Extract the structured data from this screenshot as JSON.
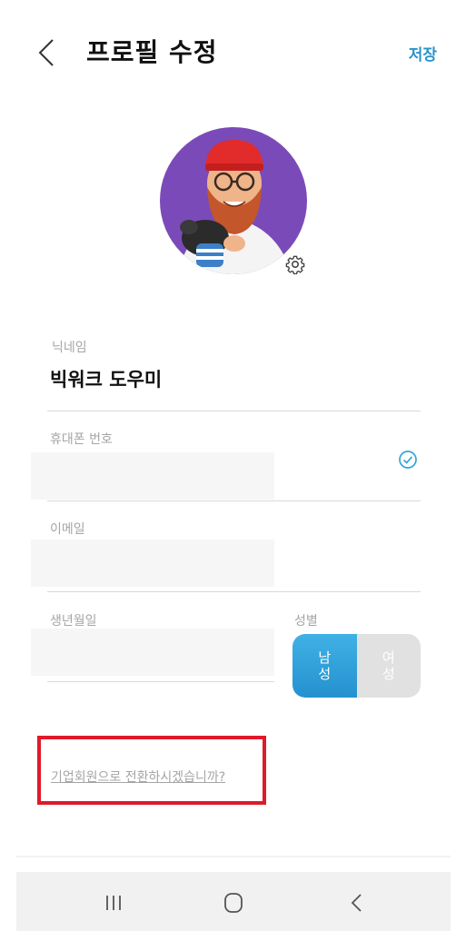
{
  "header": {
    "title": "프로필 수정",
    "save_label": "저장",
    "accent_color": "#2a93c9",
    "back_icon": "chevron-left-icon"
  },
  "profile": {
    "avatar_icon": "profile-avatar-image",
    "settings_icon": "gear-icon"
  },
  "fields": {
    "nickname": {
      "label": "닉네임",
      "value": "빅워크 도우미"
    },
    "phone": {
      "label": "휴대폰 번호",
      "verified_icon": "check-circle-icon"
    },
    "email": {
      "label": "이메일"
    },
    "birthdate": {
      "label": "생년월일"
    },
    "gender": {
      "label": "성별",
      "options": [
        "남성",
        "여성"
      ],
      "selected": "남성",
      "male_lines": [
        "남",
        "성"
      ],
      "female_lines": [
        "여",
        "성"
      ]
    }
  },
  "convert_link": "기업회원으로 전환하시겠습니까?",
  "highlight_color": "#e0192a",
  "nav": {
    "recents_icon": "recent-apps-icon",
    "home_icon": "home-icon",
    "back_icon": "back-icon"
  }
}
